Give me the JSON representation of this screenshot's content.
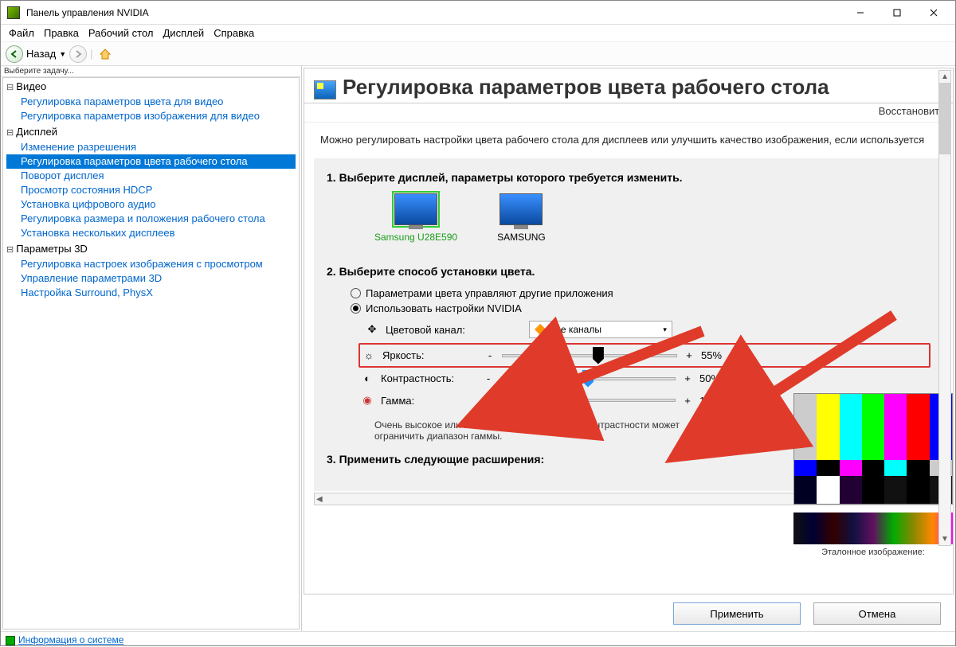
{
  "window": {
    "title": "Панель управления NVIDIA"
  },
  "menu": [
    "Файл",
    "Правка",
    "Рабочий стол",
    "Дисплей",
    "Справка"
  ],
  "toolbar": {
    "back": "Назад"
  },
  "sidebar": {
    "header": "Выберите задачу...",
    "groups": [
      {
        "title": "Видео",
        "items": [
          "Регулировка параметров цвета для видео",
          "Регулировка параметров изображения для видео"
        ]
      },
      {
        "title": "Дисплей",
        "items": [
          "Изменение разрешения",
          "Регулировка параметров цвета рабочего стола",
          "Поворот дисплея",
          "Просмотр состояния HDCP",
          "Установка цифрового аудио",
          "Регулировка размера и положения рабочего стола",
          "Установка нескольких дисплеев"
        ],
        "selected": 1
      },
      {
        "title": "Параметры 3D",
        "items": [
          "Регулировка настроек изображения с просмотром",
          "Управление параметрами 3D",
          "Настройка Surround, PhysX"
        ]
      }
    ],
    "sysinfo": "Информация о системе"
  },
  "panel": {
    "title": "Регулировка параметров цвета рабочего стола",
    "restore": "Восстановить",
    "desc": "Можно регулировать настройки цвета рабочего стола для дисплеев или улучшить качество изображения, если используется",
    "step1": {
      "title": "1. Выберите дисплей, параметры которого требуется изменить.",
      "displays": [
        {
          "name": "Samsung U28E590",
          "selected": true
        },
        {
          "name": "SAMSUNG",
          "selected": false
        }
      ]
    },
    "step2": {
      "title": "2. Выберите способ установки цвета.",
      "opt1": "Параметрами цвета управляют другие приложения",
      "opt2": "Использовать настройки NVIDIA",
      "channel_label": "Цветовой канал:",
      "channel_value": "Все каналы",
      "sliders": {
        "brightness": {
          "label": "Яркость:",
          "value": "55%",
          "pos": 55
        },
        "contrast": {
          "label": "Контрастность:",
          "value": "50%",
          "pos": 50
        },
        "gamma": {
          "label": "Гамма:",
          "value": "1.00",
          "pos": 35
        }
      },
      "note": "Очень высокое или низкое значение яркости и контрастности может ограничить диапазон гаммы."
    },
    "step3": {
      "title": "3. Применить следующие расширения:"
    },
    "ref_caption": "Эталонное изображение:"
  },
  "buttons": {
    "apply": "Применить",
    "cancel": "Отмена"
  }
}
